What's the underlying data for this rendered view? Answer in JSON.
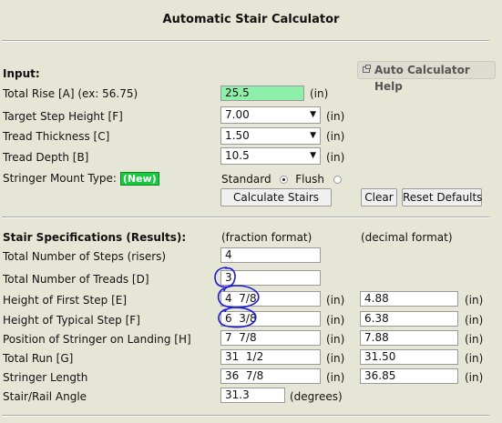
{
  "title": "Automatic Stair Calculator",
  "help_button": "Auto Calculator Help",
  "input": {
    "heading": "Input:",
    "total_rise": {
      "label": "Total Rise [A] (ex: 56.75)",
      "value": "25.5",
      "unit": "(in)"
    },
    "target_step_height": {
      "label": "Target Step Height [F]",
      "value": "7.00",
      "unit": "(in)"
    },
    "tread_thickness": {
      "label": "Tread Thickness [C]",
      "value": "1.50",
      "unit": "(in)"
    },
    "tread_depth": {
      "label": "Tread Depth [B]",
      "value": "10.5",
      "unit": "(in)"
    },
    "stringer_mount": {
      "label": "Stringer Mount Type:",
      "badge": "(New)",
      "option1": "Standard",
      "option2": "Flush",
      "selected": "Standard"
    },
    "calculate_button": "Calculate Stairs",
    "clear_button": "Clear",
    "reset_button": "Reset Defaults"
  },
  "results": {
    "heading": "Stair Specifications (Results):",
    "fraction_header": "(fraction format)",
    "decimal_header": "(decimal format)",
    "rows": [
      {
        "label": "Total Number of Steps (risers)",
        "fraction": "4"
      },
      {
        "label": "Total Number of Treads [D]",
        "fraction": "3"
      },
      {
        "label": "Height of First Step [E]",
        "fraction": "4  7/8",
        "unit": "(in)",
        "decimal": "4.88",
        "unit2": "(in)"
      },
      {
        "label": "Height of Typical  Step [F]",
        "fraction": "6  3/8",
        "unit": "(in)",
        "decimal": "6.38",
        "unit2": "(in)"
      },
      {
        "label": "Position of Stringer on Landing [H]",
        "fraction": "7  7/8",
        "unit": "(in)",
        "decimal": "7.88",
        "unit2": "(in)"
      },
      {
        "label": "Total Run [G]",
        "fraction": "31  1/2",
        "unit": "(in)",
        "decimal": "31.50",
        "unit2": "(in)"
      },
      {
        "label": "Stringer Length",
        "fraction": "36  7/8",
        "unit": "(in)",
        "decimal": "36.85",
        "unit2": "(in)"
      },
      {
        "label": "Stair/Rail Angle",
        "fraction": "31.3",
        "unit": "(degrees)"
      }
    ]
  },
  "colors": {
    "background": "#e6e6d6",
    "highlight_input": "#8ef0a8",
    "annotation": "#1a1ad8",
    "badge": "#18c840"
  }
}
